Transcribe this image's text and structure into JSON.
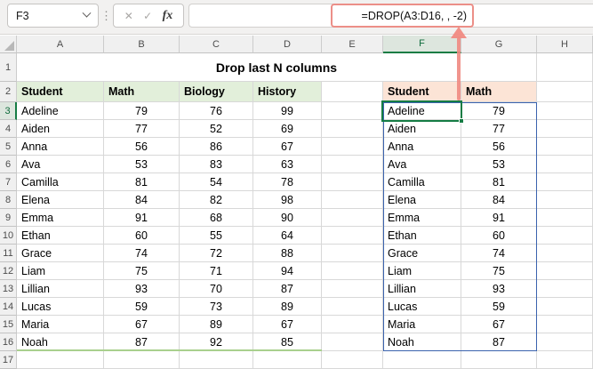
{
  "toolbar": {
    "name_box_value": "F3",
    "formula": "=DROP(A3:D16, , -2)",
    "icons": {
      "chevron_down": "⌄",
      "menu_dots": "⋮",
      "cancel": "✕",
      "enter": "✓",
      "function": "fx"
    }
  },
  "sheet": {
    "title": "Drop last N columns",
    "column_headers": [
      "A",
      "B",
      "C",
      "D",
      "E",
      "F",
      "G",
      "H"
    ],
    "row_numbers": [
      "1",
      "2",
      "3",
      "4",
      "5",
      "6",
      "7",
      "8",
      "9",
      "10",
      "11",
      "12",
      "13",
      "14",
      "15",
      "16",
      "17"
    ],
    "selected_cell": "F3",
    "selected_column": "F",
    "selected_row": "3",
    "left_table": {
      "headers": [
        "Student",
        "Math",
        "Biology",
        "History"
      ],
      "rows": [
        [
          "Adeline",
          79,
          76,
          99
        ],
        [
          "Aiden",
          77,
          52,
          69
        ],
        [
          "Anna",
          56,
          86,
          67
        ],
        [
          "Ava",
          53,
          83,
          63
        ],
        [
          "Camilla",
          81,
          54,
          78
        ],
        [
          "Elena",
          84,
          82,
          98
        ],
        [
          "Emma",
          91,
          68,
          90
        ],
        [
          "Ethan",
          60,
          55,
          64
        ],
        [
          "Grace",
          74,
          72,
          88
        ],
        [
          "Liam",
          75,
          71,
          94
        ],
        [
          "Lillian",
          93,
          70,
          87
        ],
        [
          "Lucas",
          59,
          73,
          89
        ],
        [
          "Maria",
          67,
          89,
          67
        ],
        [
          "Noah",
          87,
          92,
          85
        ]
      ]
    },
    "right_table": {
      "headers": [
        "Student",
        "Math"
      ],
      "rows": [
        [
          "Adeline",
          79
        ],
        [
          "Aiden",
          77
        ],
        [
          "Anna",
          56
        ],
        [
          "Ava",
          53
        ],
        [
          "Camilla",
          81
        ],
        [
          "Elena",
          84
        ],
        [
          "Emma",
          91
        ],
        [
          "Ethan",
          60
        ],
        [
          "Grace",
          74
        ],
        [
          "Liam",
          75
        ],
        [
          "Lillian",
          93
        ],
        [
          "Lucas",
          59
        ],
        [
          "Maria",
          67
        ],
        [
          "Noah",
          87
        ]
      ]
    }
  },
  "colors": {
    "left_header_fill": "#E2EFDA",
    "right_header_fill": "#FCE4D6",
    "selection_green": "#157C44",
    "spill_border_blue": "#3B63AE",
    "annotation_red": "#F08A82",
    "table_bottom_border_green": "#A9D08E"
  }
}
